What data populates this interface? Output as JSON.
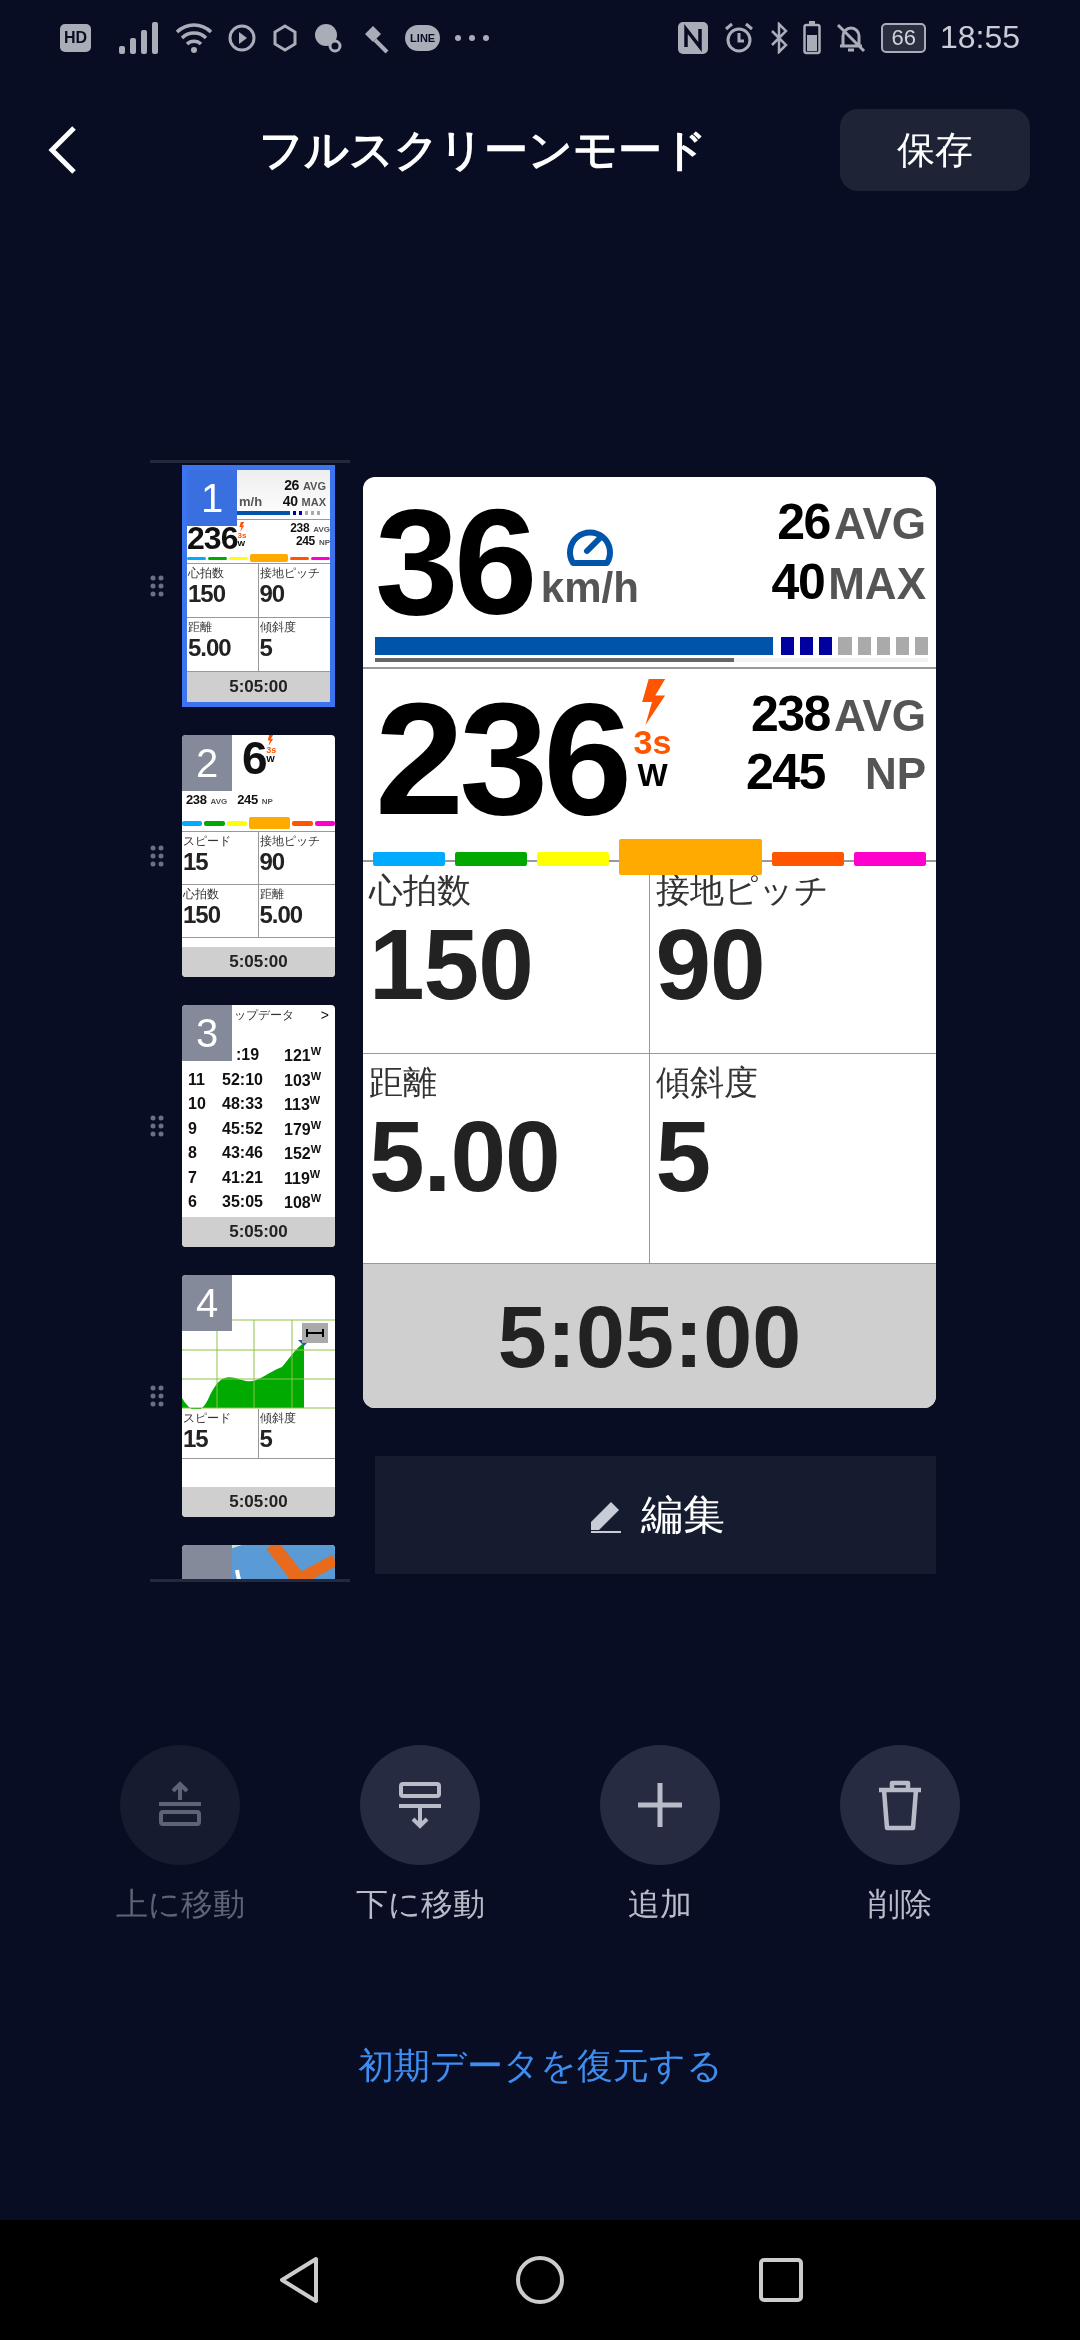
{
  "status_bar": {
    "hd": "HD",
    "line": "LINE",
    "battery": "66",
    "time": "18:55"
  },
  "header": {
    "title": "フルスクリーンモード",
    "save": "保存"
  },
  "pages": [
    {
      "kind": "speed_power",
      "number": "1",
      "selected": true,
      "unit": "m/h",
      "avg": "26",
      "avg_label": "AVG",
      "max": "40",
      "max_label": "MAX",
      "power": "236",
      "power_sub": "3s",
      "power_unit": "W",
      "power_avg": "238",
      "power_avg_label": "AVG",
      "np": "245",
      "np_label": "NP",
      "fields": [
        {
          "label": "心拍数",
          "value": "150"
        },
        {
          "label": "接地ピッチ",
          "value": "90"
        },
        {
          "label": "距離",
          "value": "5.00"
        },
        {
          "label": "傾斜度",
          "value": "5"
        }
      ],
      "time": "5:05:00"
    },
    {
      "kind": "power",
      "number": "2",
      "selected": false,
      "power": "6",
      "power_sub": "3s",
      "power_unit": "W",
      "power_avg": "238",
      "power_avg_label": "AVG",
      "np": "245",
      "np_label": "NP",
      "fields": [
        {
          "label": "スピード",
          "value": "15"
        },
        {
          "label": "接地ピッチ",
          "value": "90"
        },
        {
          "label": "心拍数",
          "value": "150"
        },
        {
          "label": "距離",
          "value": "5.00"
        }
      ],
      "time": "5:05:00"
    },
    {
      "kind": "laps",
      "number": "3",
      "selected": false,
      "title": "ップデータ",
      "chevron": ">",
      "rows": [
        {
          "time": ":19",
          "power": "121",
          "unit": "W"
        },
        {
          "lap": "11",
          "time": "52:10",
          "power": "103",
          "unit": "W"
        },
        {
          "lap": "10",
          "time": "48:33",
          "power": "113",
          "unit": "W"
        },
        {
          "lap": "9",
          "time": "45:52",
          "power": "179",
          "unit": "W"
        },
        {
          "lap": "8",
          "time": "43:46",
          "power": "152",
          "unit": "W"
        },
        {
          "lap": "7",
          "time": "41:21",
          "power": "119",
          "unit": "W"
        },
        {
          "lap": "6",
          "time": "35:05",
          "power": "108",
          "unit": "W"
        }
      ],
      "time": "5:05:00"
    },
    {
      "kind": "elevation",
      "number": "4",
      "selected": false,
      "fields": [
        {
          "label": "スピード",
          "value": "15"
        },
        {
          "label": "傾斜度",
          "value": "5"
        }
      ],
      "time": "5:05:00"
    },
    {
      "kind": "map",
      "selected": false
    }
  ],
  "preview": {
    "speed": "36",
    "unit": "km/h",
    "avg": "26",
    "avg_label": "AVG",
    "max": "40",
    "max_label": "MAX",
    "speed_gauge": {
      "level": 0.72
    },
    "avg_marker": {
      "level": 0.65
    },
    "power": "236",
    "power_sub": "3s",
    "power_unit": "W",
    "power_avg": "238",
    "power_avg_label": "AVG",
    "np": "245",
    "np_label": "NP",
    "zones": [
      {
        "color": "#00aaff",
        "selected": false
      },
      {
        "color": "#00a800",
        "selected": false
      },
      {
        "color": "#ffff00",
        "selected": false
      },
      {
        "color": "#ffaa00",
        "selected": true
      },
      {
        "color": "#ff5500",
        "selected": false
      },
      {
        "color": "#ff00cc",
        "selected": false
      }
    ],
    "fields": [
      {
        "label": "心拍数",
        "value": "150"
      },
      {
        "label": "接地ピッチ",
        "value": "90"
      },
      {
        "label": "距離",
        "value": "5.00"
      },
      {
        "label": "傾斜度",
        "value": "5"
      }
    ],
    "time": "5:05:00"
  },
  "edit_button": "編集",
  "actions": [
    {
      "kind": "up",
      "label": "上に移動",
      "disabled": true
    },
    {
      "kind": "down",
      "label": "下に移動",
      "disabled": false
    },
    {
      "kind": "add",
      "label": "追加",
      "disabled": false
    },
    {
      "kind": "delete",
      "label": "削除",
      "disabled": false
    }
  ],
  "restore_link": "初期データを復元する"
}
